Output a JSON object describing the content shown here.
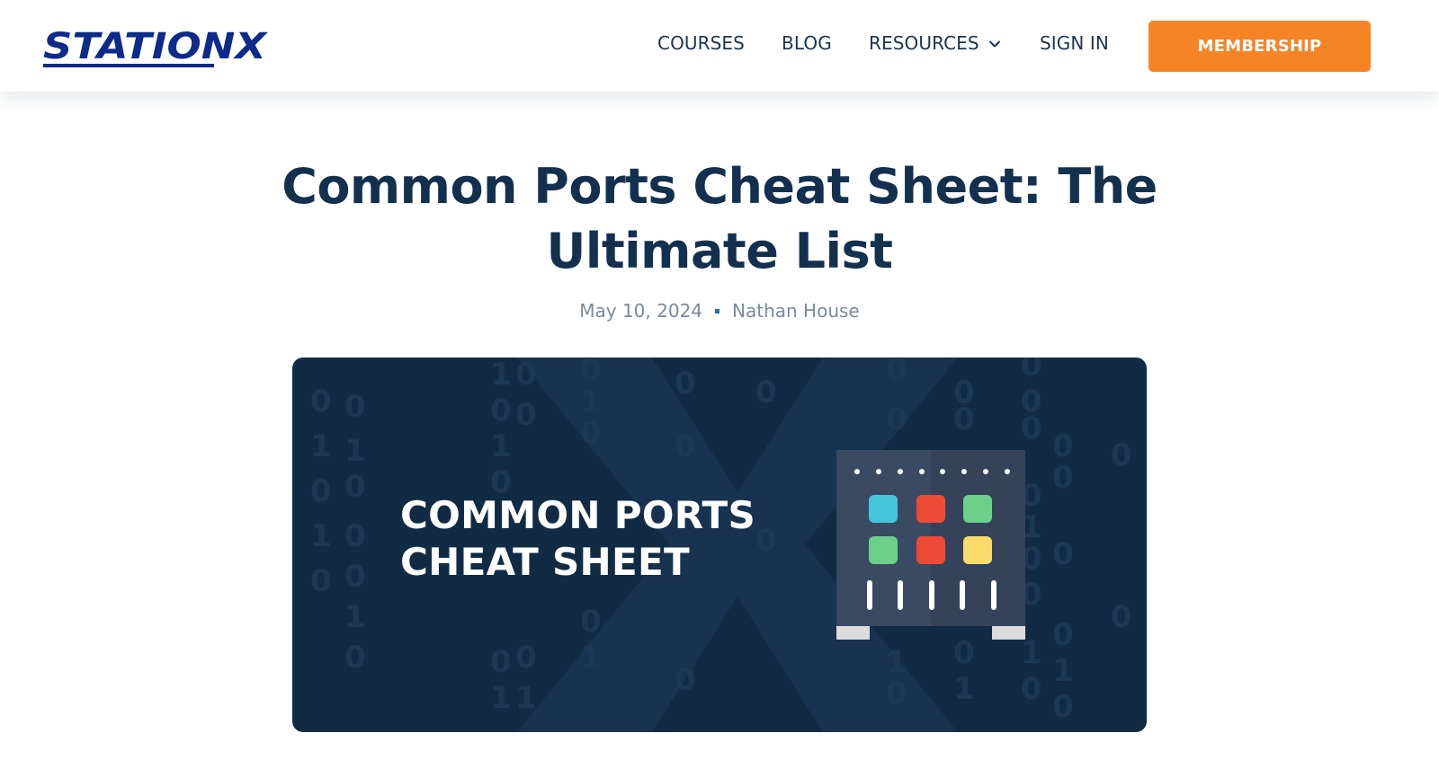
{
  "header": {
    "logo_text": "STATIONX",
    "nav": {
      "courses": "COURSES",
      "blog": "BLOG",
      "resources": "RESOURCES",
      "sign_in": "SIGN IN"
    },
    "membership_label": "MEMBERSHIP",
    "colors": {
      "brand_navy": "#0e2a8a",
      "accent_orange": "#f58426"
    }
  },
  "article": {
    "title": "Common Ports Cheat Sheet: The Ultimate List",
    "date": "May 10, 2024",
    "author": "Nathan House",
    "hero": {
      "line1": "COMMON PORTS",
      "line2": "CHEAT SHEET",
      "icon": "network-switch-icon",
      "background_color": "#112b44"
    }
  }
}
